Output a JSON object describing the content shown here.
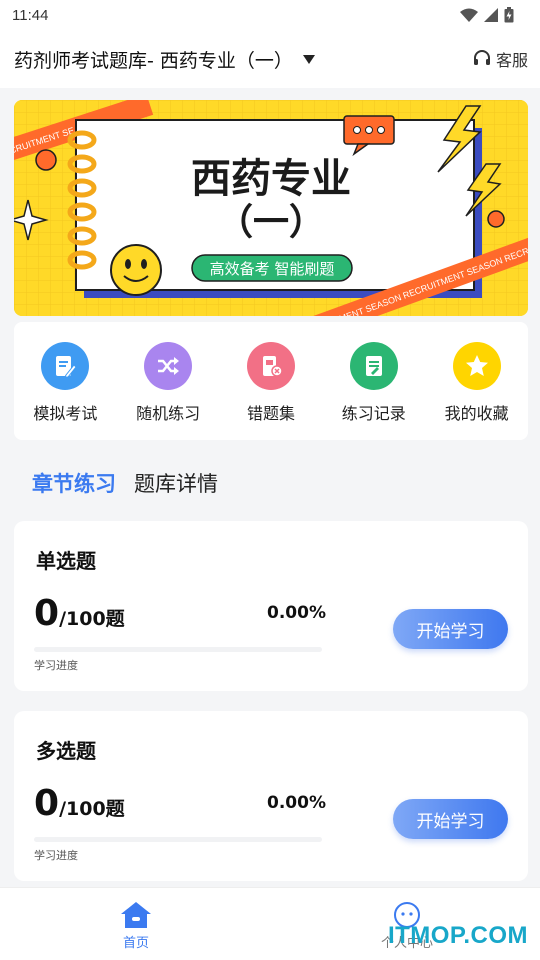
{
  "status_bar": {
    "time": "11:44"
  },
  "app_bar": {
    "title": "药剂师考试题库- 西药专业（一）",
    "service_label": "客服"
  },
  "banner": {
    "title_line1": "西药专业",
    "title_line2": "（一）",
    "subtitle": "高效备考  智能刷题",
    "ribbon_text": "RECRUITMENT SEASON",
    "ribbon_text_right": "RECRUITMENT SEASON  RECRUITMENT SEASON  RECR"
  },
  "quick_actions": [
    {
      "label": "模拟考试",
      "icon": "exam-edit-icon",
      "color": "#3f9bf2"
    },
    {
      "label": "随机练习",
      "icon": "shuffle-icon",
      "color": "#a985ef"
    },
    {
      "label": "错题集",
      "icon": "wrong-set-icon",
      "color": "#f27086"
    },
    {
      "label": "练习记录",
      "icon": "record-icon",
      "color": "#2bb673"
    },
    {
      "label": "我的收藏",
      "icon": "star-icon",
      "color": "#ffd500"
    }
  ],
  "tabs": [
    {
      "label": "章节练习",
      "active": true
    },
    {
      "label": "题库详情",
      "active": false
    }
  ],
  "cards": [
    {
      "title": "单选题",
      "done": "0",
      "total": "/100题",
      "percent": "0.00%",
      "progress": 0,
      "progress_label": "学习进度",
      "button": "开始学习"
    },
    {
      "title": "多选题",
      "done": "0",
      "total": "/100题",
      "percent": "0.00%",
      "progress": 0,
      "progress_label": "学习进度",
      "button": "开始学习"
    }
  ],
  "bottom_nav": {
    "home_label": "首页",
    "me_label": "个人中心"
  },
  "watermark": "ITMOP.COM",
  "colors": {
    "accent": "#3b7af0",
    "banner_yellow": "#ffd928",
    "ribbon_orange": "#ff6a2b"
  }
}
